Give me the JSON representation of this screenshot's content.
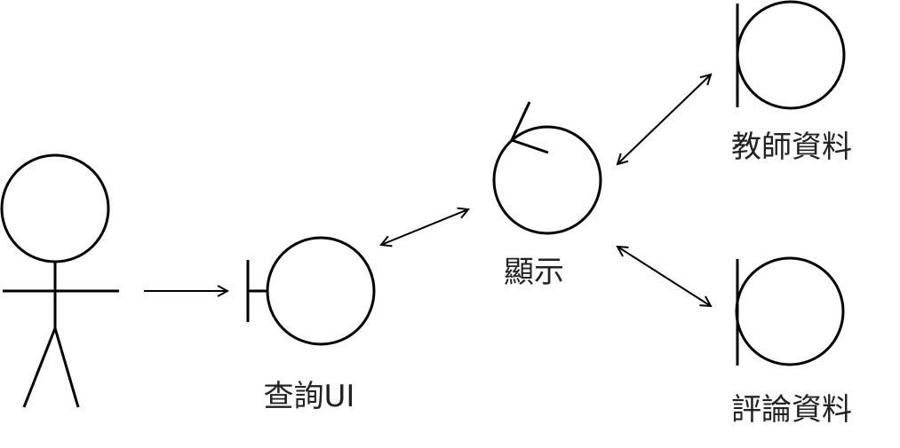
{
  "diagram": {
    "elements": {
      "actor": {
        "kind": "actor",
        "label": ""
      },
      "query_ui": {
        "kind": "boundary",
        "label": "查詢UI"
      },
      "display": {
        "kind": "control",
        "label": "顯示"
      },
      "teacher_data": {
        "kind": "entity",
        "label": "教師資料"
      },
      "review_data": {
        "kind": "entity",
        "label": "評論資料"
      }
    },
    "connections": [
      {
        "from": "actor",
        "to": "query_ui",
        "direction": "one-way"
      },
      {
        "from": "query_ui",
        "to": "display",
        "direction": "two-way"
      },
      {
        "from": "display",
        "to": "teacher_data",
        "direction": "two-way"
      },
      {
        "from": "display",
        "to": "review_data",
        "direction": "two-way"
      }
    ],
    "colors": {
      "stroke": "#000000",
      "text": "#222222",
      "background": "#ffffff"
    }
  }
}
